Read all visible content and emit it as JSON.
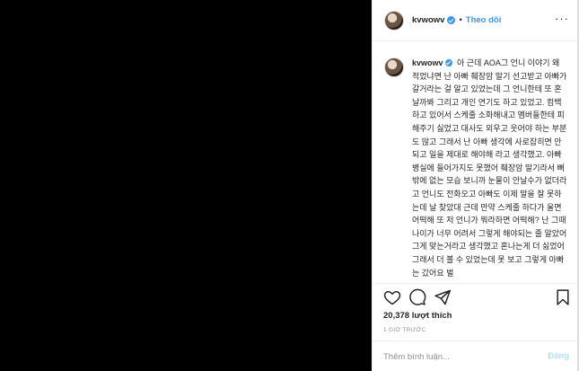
{
  "post": {
    "username": "kvwowv",
    "follow_label": "Theo dõi",
    "separator": "•",
    "more_label": "···"
  },
  "caption": {
    "username": "kvwowv",
    "text": "아 근데 AOA그 언니 이야기 왜 적었냐면 난 아빠 췌장암 말기 선고받고 아빠가 갈거라는 걸 알고 있었는데 그 언니한테 또 혼날까봐 그리고 개인 연기도 하고 있었고. 컴백하고 있어서 스케줄 소화해내고 멤버들한테 피해주기 싫었고 대사도 외우고 웃어야 하는 부분도 많고 그래서 난 아빠 생각에 사로잡히면 안되고 일을 제대로 해야해 라고 생각했고. 아빠 병실에 들어가지도 못했어 췌장암 말기라서 뼈밖에 없는 모습 보니까 눈물이 안날수가 없더라고 언니도 전화오고 아빠도 이제 말을 잘 못하는데 날 찾았대 근데 만약 스케줄 하다가 울면 어떡해 또 저 언니가 뭐라하면 어떡해? 난 그때 나이가 너무 어려서 그렇게 해야되는 줄 알았어 그게 맞는거라고 생각했고 혼나는게 더 싫었어 그래서 더 볼 수 있었는데 못 보고 그렇게 아빠 는 갔어요 벌"
  },
  "actions": {
    "like_icon": "heart-icon",
    "comment_icon": "comment-icon",
    "share_icon": "share-icon",
    "save_icon": "bookmark-icon"
  },
  "stats": {
    "likes": "20,378 lượt thích",
    "time": "1 GIỜ TRƯỚC"
  },
  "comment": {
    "placeholder": "Thêm bình luận...",
    "post_label": "Đăng"
  },
  "colors": {
    "accent": "#3897f0",
    "post_disabled": "#b2dffc",
    "muted": "#8e8e8e",
    "media_bg": "#000000"
  }
}
